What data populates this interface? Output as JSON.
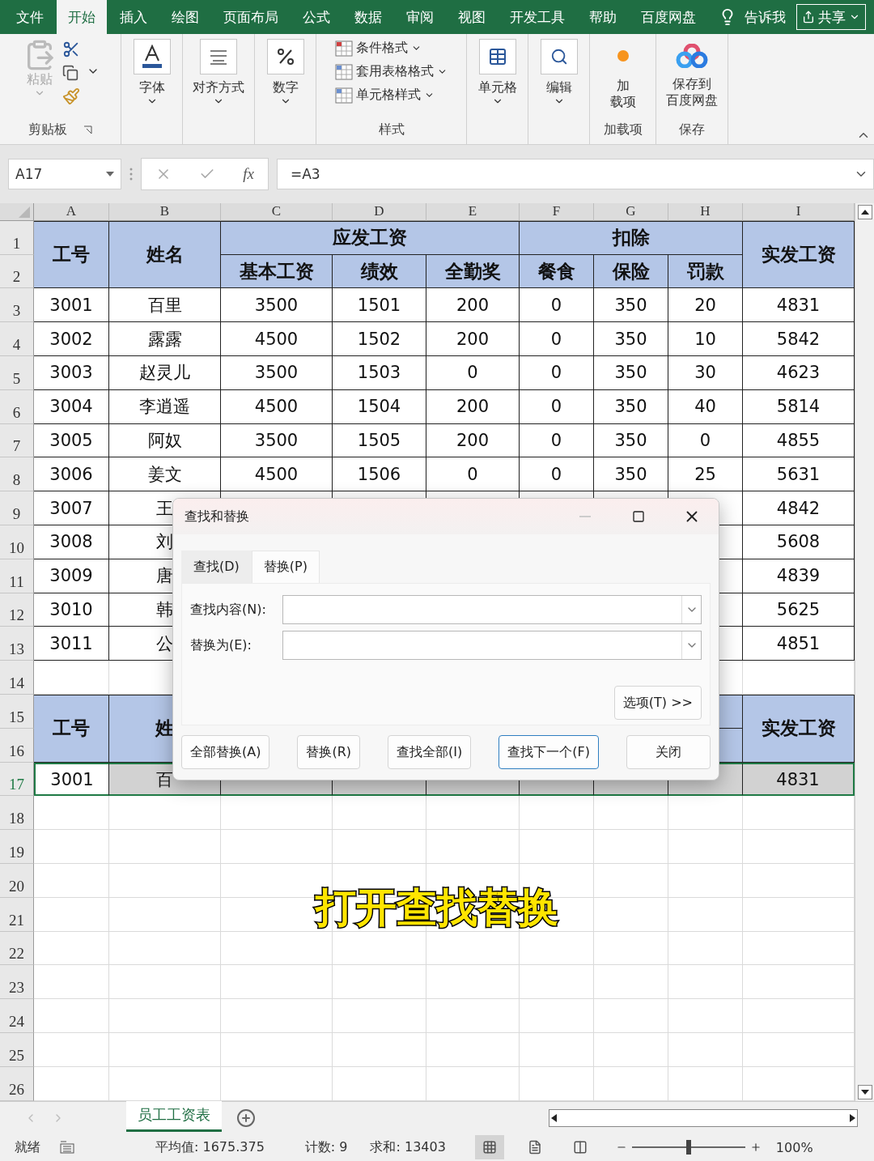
{
  "menu_tabs": [
    {
      "label": "文件",
      "selected": false
    },
    {
      "label": "开始",
      "selected": true
    },
    {
      "label": "插入",
      "selected": false
    },
    {
      "label": "绘图",
      "selected": false
    },
    {
      "label": "页面布局",
      "selected": false
    },
    {
      "label": "公式",
      "selected": false
    },
    {
      "label": "数据",
      "selected": false
    },
    {
      "label": "审阅",
      "selected": false
    },
    {
      "label": "视图",
      "selected": false
    },
    {
      "label": "开发工具",
      "selected": false
    },
    {
      "label": "帮助",
      "selected": false
    },
    {
      "label": "百度网盘",
      "selected": false
    }
  ],
  "tell_me": "告诉我",
  "share_button": "共享",
  "ribbon": {
    "groups": [
      {
        "kind": "clipboard",
        "label": "剪贴板",
        "paste": {
          "label": "粘贴",
          "disabled": true
        }
      },
      {
        "kind": "single",
        "button": {
          "kind": "font",
          "lines": [
            "字体"
          ],
          "dropdown": true
        }
      },
      {
        "kind": "single",
        "button": {
          "kind": "align",
          "lines": [
            "对齐方式"
          ],
          "dropdown": true
        }
      },
      {
        "kind": "single",
        "button": {
          "kind": "number",
          "lines": [
            "数字"
          ],
          "dropdown": true
        }
      },
      {
        "kind": "list",
        "label": "样式",
        "items": [
          "条件格式",
          "套用表格格式",
          "单元格样式"
        ]
      },
      {
        "kind": "single",
        "button": {
          "kind": "cells",
          "lines": [
            "单元格"
          ],
          "dropdown": true
        }
      },
      {
        "kind": "single",
        "button": {
          "kind": "edit",
          "lines": [
            "编辑"
          ],
          "dropdown": true
        }
      },
      {
        "kind": "single",
        "label": "加载项",
        "button": {
          "kind": "addin",
          "lines": [
            "加",
            "载项"
          ],
          "dropdown": false
        }
      },
      {
        "kind": "single",
        "label": "保存",
        "button": {
          "kind": "cloud",
          "lines": [
            "保存到",
            "百度网盘"
          ],
          "dropdown": false
        }
      }
    ]
  },
  "formula_bar": {
    "name_box": "A17",
    "function_button": "fx",
    "formula": "=A3"
  },
  "column_headers": [
    "A",
    "B",
    "C",
    "D",
    "E",
    "F",
    "G",
    "H",
    "I"
  ],
  "row_numbers": [
    "1",
    "2",
    "3",
    "4",
    "5",
    "6",
    "7",
    "8",
    "9",
    "10",
    "11",
    "12",
    "13",
    "14",
    "15",
    "16",
    "17",
    "18",
    "19",
    "20",
    "21",
    "22",
    "23",
    "24",
    "25",
    "26"
  ],
  "table": {
    "header": {
      "main": [
        "工号",
        "姓名",
        "应发工资",
        "扣除"
      ],
      "sub": [
        "基本工资",
        "绩效",
        "全勤奖",
        "餐食",
        "保险",
        "罚款"
      ],
      "total": "实发工资"
    },
    "rows": [
      {
        "selected": false,
        "cells": [
          "3001",
          "百里",
          "3500",
          "1501",
          "200",
          "0",
          "350",
          "20"
        ],
        "total": "4831"
      },
      {
        "selected": false,
        "cells": [
          "3002",
          "露露",
          "4500",
          "1502",
          "200",
          "0",
          "350",
          "10"
        ],
        "total": "5842"
      },
      {
        "selected": false,
        "cells": [
          "3003",
          "赵灵儿",
          "3500",
          "1503",
          "0",
          "0",
          "350",
          "30"
        ],
        "total": "4623"
      },
      {
        "selected": false,
        "cells": [
          "3004",
          "李逍遥",
          "4500",
          "1504",
          "200",
          "0",
          "350",
          "40"
        ],
        "total": "5814"
      },
      {
        "selected": false,
        "cells": [
          "3005",
          "阿奴",
          "3500",
          "1505",
          "200",
          "0",
          "350",
          "0"
        ],
        "total": "4855"
      },
      {
        "selected": false,
        "cells": [
          "3006",
          "姜文",
          "4500",
          "1506",
          "0",
          "0",
          "350",
          "25"
        ],
        "total": "5631"
      },
      {
        "selected": false,
        "cells": [
          "3007",
          "王"
        ],
        "total": "4842"
      },
      {
        "selected": false,
        "cells": [
          "3008",
          "刘"
        ],
        "total": "5608"
      },
      {
        "selected": false,
        "cells": [
          "3009",
          "唐"
        ],
        "total": "4839"
      },
      {
        "selected": false,
        "cells": [
          "3010",
          "韩"
        ],
        "total": "5625"
      },
      {
        "selected": false,
        "cells": [
          "3011",
          "公"
        ],
        "total": "4851"
      }
    ]
  },
  "lookup_table": {
    "header": {
      "main": [
        "工号",
        "姓"
      ],
      "total": "实发工资"
    },
    "rows": [
      {
        "selected": true,
        "cells": [
          "3001",
          "百"
        ],
        "total": "4831"
      }
    ]
  },
  "dialog": {
    "title": "查找和替换",
    "tabs": [
      {
        "label": "查找(D)",
        "selected": false
      },
      {
        "label": "替换(P)",
        "selected": true
      }
    ],
    "fields": [
      {
        "label": "查找内容(N):"
      },
      {
        "label": "替换为(E):"
      }
    ],
    "options_button": "选项(T) >>",
    "buttons": [
      {
        "label": "全部替换(A)",
        "default": false
      },
      {
        "label": "替换(R)",
        "default": false
      },
      {
        "label": "查找全部(I)",
        "default": false
      },
      {
        "label": "查找下一个(F)",
        "default": true
      },
      {
        "label": "关闭",
        "default": false
      }
    ]
  },
  "caption": "打开查找替换",
  "sheet_tabs": [
    {
      "label": "员工工资表",
      "selected": true
    }
  ],
  "status_bar": {
    "status": "就绪",
    "average": "平均值: 1675.375",
    "count": "计数: 9",
    "sum": "求和: 13403",
    "views": [
      {
        "kind": "normal",
        "selected": true
      },
      {
        "kind": "layout",
        "selected": false
      },
      {
        "kind": "pagebreak",
        "selected": false
      }
    ],
    "zoom": {
      "level": 0.5,
      "reading": "100%"
    }
  }
}
